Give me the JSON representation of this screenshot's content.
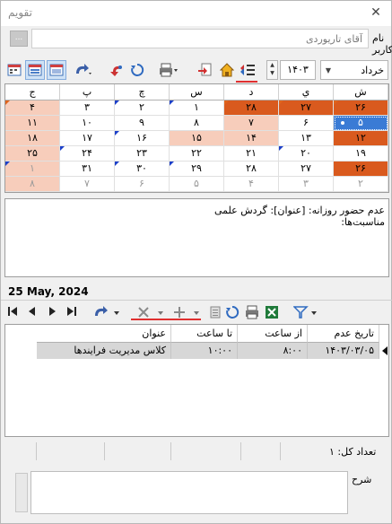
{
  "window": {
    "title": "تقویم",
    "close_glyph": "✕"
  },
  "user": {
    "label": "نام کاربر",
    "value": "آقای تاریوردی",
    "browse_label": "..."
  },
  "toolbar": {
    "month_options": [
      "خرداد"
    ],
    "month_selected": "خرداد",
    "year": "۱۴۰۳",
    "icons": [
      "day-view-icon",
      "week-view-icon",
      "month-view-icon",
      "redo-icon",
      "undo-icon",
      "refresh-icon",
      "print-icon",
      "export-icon",
      "home-icon",
      "events-list-icon"
    ]
  },
  "calendar": {
    "weekdays": [
      "ش",
      "ي",
      "د",
      "س",
      "چ",
      "پ",
      "ج"
    ],
    "weeks": [
      [
        "۲۶",
        "۲۷",
        "۲۸",
        "۱",
        "۲",
        "۳",
        "۴"
      ],
      [
        "۵",
        "۶",
        "۷",
        "۸",
        "۹",
        "۱۰",
        "۱۱"
      ],
      [
        "۱۲",
        "۱۳",
        "۱۴",
        "۱۵",
        "۱۶",
        "۱۷",
        "۱۸"
      ],
      [
        "۱۹",
        "۲۰",
        "۲۱",
        "۲۲",
        "۲۳",
        "۲۴",
        "۲۵"
      ],
      [
        "۲۶",
        "۲۷",
        "۲۸",
        "۲۹",
        "۳۰",
        "۳۱",
        "۱"
      ],
      [
        "۲",
        "۳",
        "۴",
        "۵",
        "۶",
        "۷",
        "۸"
      ]
    ],
    "colors": {
      "holiday": "#d95a1e",
      "light_holiday": "#f7cdbb",
      "selected": "#3a7bd5",
      "marker": "#1b3fc9"
    }
  },
  "notes": {
    "line1": "عدم حضور روزانه: [عنوان]: گردش علمی",
    "line2": "مناسبت‌ها:"
  },
  "selected_date": "25 May, 2024",
  "grid": {
    "columns": [
      "تاریخ عدم حضور",
      "از ساعت",
      "تا ساعت",
      "عنوان"
    ],
    "rows": [
      [
        "۱۴۰۳/۰۳/۰۵",
        "۸:۰۰",
        "۱۰:۰۰",
        "کلاس مدیریت فرایندها"
      ]
    ]
  },
  "status": {
    "total": "تعداد کل: ۱"
  },
  "description": {
    "label": "شرح",
    "value": ""
  }
}
